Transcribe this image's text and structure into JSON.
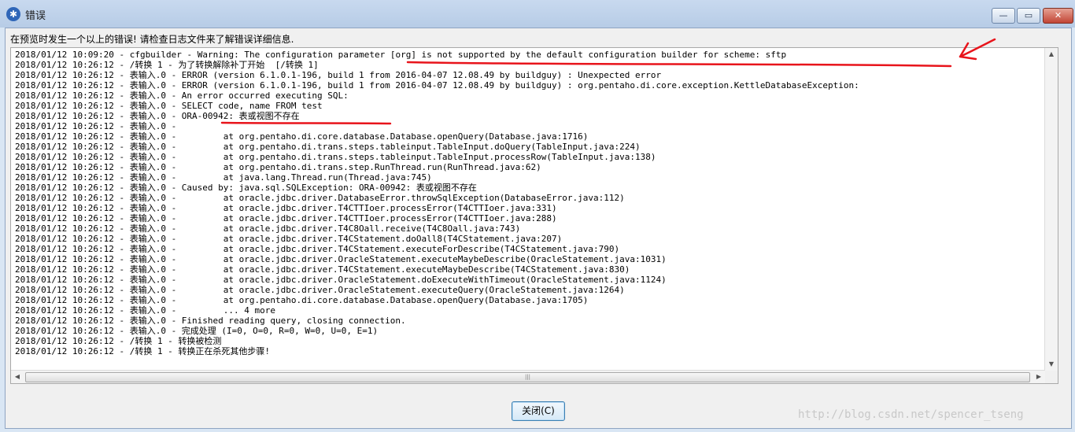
{
  "window": {
    "title": "错误",
    "minimize_glyph": "—",
    "maximize_glyph": "▭",
    "close_glyph": "✕"
  },
  "message": "在预览时发生一个以上的错误! 请检查日志文件来了解错误详细信息.",
  "log_lines": [
    "2018/01/12 10:09:20 - cfgbuilder - Warning: The configuration parameter [org] is not supported by the default configuration builder for scheme: sftp",
    "2018/01/12 10:26:12 - /转换 1 - 为了转换解除补丁开始  [/转换 1]",
    "2018/01/12 10:26:12 - 表输入.0 - ERROR (version 6.1.0.1-196, build 1 from 2016-04-07 12.08.49 by buildguy) : Unexpected error",
    "2018/01/12 10:26:12 - 表输入.0 - ERROR (version 6.1.0.1-196, build 1 from 2016-04-07 12.08.49 by buildguy) : org.pentaho.di.core.exception.KettleDatabaseException:",
    "2018/01/12 10:26:12 - 表输入.0 - An error occurred executing SQL:",
    "2018/01/12 10:26:12 - 表输入.0 - SELECT code, name FROM test",
    "2018/01/12 10:26:12 - 表输入.0 - ORA-00942: 表或视图不存在",
    "2018/01/12 10:26:12 - 表输入.0 -",
    "2018/01/12 10:26:12 - 表输入.0 -         at org.pentaho.di.core.database.Database.openQuery(Database.java:1716)",
    "2018/01/12 10:26:12 - 表输入.0 -         at org.pentaho.di.trans.steps.tableinput.TableInput.doQuery(TableInput.java:224)",
    "2018/01/12 10:26:12 - 表输入.0 -         at org.pentaho.di.trans.steps.tableinput.TableInput.processRow(TableInput.java:138)",
    "2018/01/12 10:26:12 - 表输入.0 -         at org.pentaho.di.trans.step.RunThread.run(RunThread.java:62)",
    "2018/01/12 10:26:12 - 表输入.0 -         at java.lang.Thread.run(Thread.java:745)",
    "2018/01/12 10:26:12 - 表输入.0 - Caused by: java.sql.SQLException: ORA-00942: 表或视图不存在",
    "2018/01/12 10:26:12 - 表输入.0 -         at oracle.jdbc.driver.DatabaseError.throwSqlException(DatabaseError.java:112)",
    "2018/01/12 10:26:12 - 表输入.0 -         at oracle.jdbc.driver.T4CTTIoer.processError(T4CTTIoer.java:331)",
    "2018/01/12 10:26:12 - 表输入.0 -         at oracle.jdbc.driver.T4CTTIoer.processError(T4CTTIoer.java:288)",
    "2018/01/12 10:26:12 - 表输入.0 -         at oracle.jdbc.driver.T4C8Oall.receive(T4C8Oall.java:743)",
    "2018/01/12 10:26:12 - 表输入.0 -         at oracle.jdbc.driver.T4CStatement.doOall8(T4CStatement.java:207)",
    "2018/01/12 10:26:12 - 表输入.0 -         at oracle.jdbc.driver.T4CStatement.executeForDescribe(T4CStatement.java:790)",
    "2018/01/12 10:26:12 - 表输入.0 -         at oracle.jdbc.driver.OracleStatement.executeMaybeDescribe(OracleStatement.java:1031)",
    "2018/01/12 10:26:12 - 表输入.0 -         at oracle.jdbc.driver.T4CStatement.executeMaybeDescribe(T4CStatement.java:830)",
    "2018/01/12 10:26:12 - 表输入.0 -         at oracle.jdbc.driver.OracleStatement.doExecuteWithTimeout(OracleStatement.java:1124)",
    "2018/01/12 10:26:12 - 表输入.0 -         at oracle.jdbc.driver.OracleStatement.executeQuery(OracleStatement.java:1264)",
    "2018/01/12 10:26:12 - 表输入.0 -         at org.pentaho.di.core.database.Database.openQuery(Database.java:1705)",
    "2018/01/12 10:26:12 - 表输入.0 -         ... 4 more",
    "2018/01/12 10:26:12 - 表输入.0 - Finished reading query, closing connection.",
    "2018/01/12 10:26:12 - 表输入.0 - 完成处理 (I=0, O=0, R=0, W=0, U=0, E=1)",
    "2018/01/12 10:26:12 - /转换 1 - 转换被检测",
    "2018/01/12 10:26:12 - /转换 1 - 转换正在杀死其他步骤!"
  ],
  "close_button_label": "关闭(C)",
  "watermark": "http://blog.csdn.net/spencer_tseng",
  "annotation_color": "#e8141b"
}
